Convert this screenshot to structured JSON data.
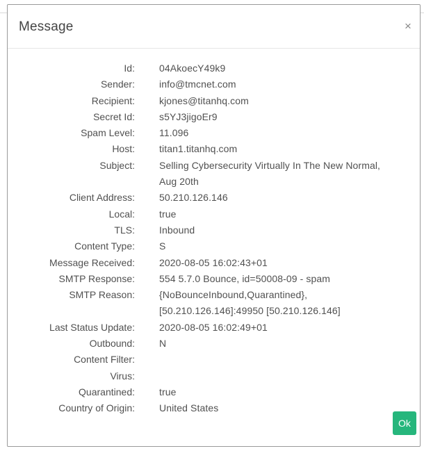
{
  "dialog": {
    "title": "Message",
    "close_icon": "×",
    "ok_label": "Ok"
  },
  "fields": [
    {
      "label": "Id:",
      "value": "04AkoecY49k9"
    },
    {
      "label": "Sender:",
      "value": "info@tmcnet.com"
    },
    {
      "label": "Recipient:",
      "value": "kjones@titanhq.com"
    },
    {
      "label": "Secret Id:",
      "value": "s5YJ3jigoEr9"
    },
    {
      "label": "Spam Level:",
      "value": "11.096"
    },
    {
      "label": "Host:",
      "value": "titan1.titanhq.com"
    },
    {
      "label": "Subject:",
      "value": "Selling Cybersecurity Virtually In The New Normal, Aug 20th"
    },
    {
      "label": "Client Address:",
      "value": "50.210.126.146"
    },
    {
      "label": "Local:",
      "value": "true"
    },
    {
      "label": "TLS:",
      "value": "Inbound"
    },
    {
      "label": "Content Type:",
      "value": "S"
    },
    {
      "label": "Message Received:",
      "value": "2020-08-05 16:02:43+01"
    },
    {
      "label": "SMTP Response:",
      "value": "554 5.7.0 Bounce, id=50008-09 - spam"
    },
    {
      "label": "SMTP Reason:",
      "value": "{NoBounceInbound,Quarantined}, [50.210.126.146]:49950 [50.210.126.146]"
    },
    {
      "label": "Last Status Update:",
      "value": "2020-08-05 16:02:49+01"
    },
    {
      "label": "Outbound:",
      "value": "N"
    },
    {
      "label": "Content Filter:",
      "value": ""
    },
    {
      "label": "Virus:",
      "value": ""
    },
    {
      "label": "Quarantined:",
      "value": "true"
    },
    {
      "label": "Country of Origin:",
      "value": "United States"
    }
  ],
  "colors": {
    "ok_button": "#26b67c",
    "border": "#9a9a9a"
  }
}
